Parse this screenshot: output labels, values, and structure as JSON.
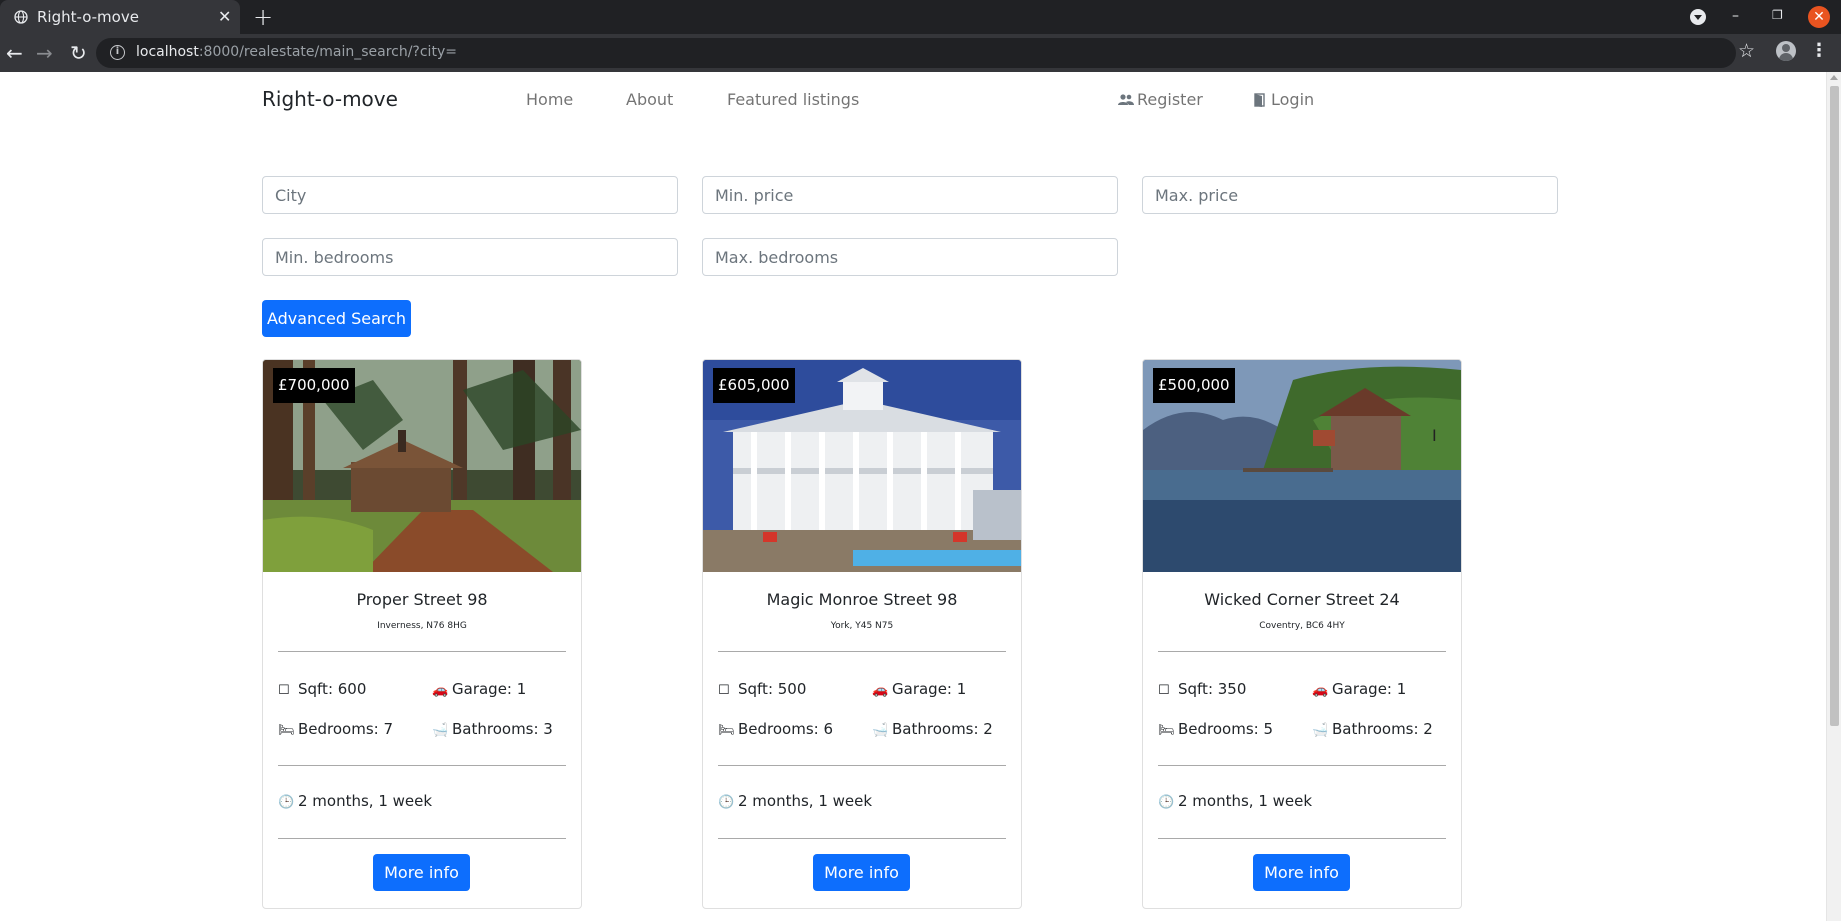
{
  "browser": {
    "tab_title": "Right-o-move",
    "url_host": "localhost",
    "url_rest": ":8000/realestate/main_search/?city="
  },
  "site": {
    "brand": "Right-o-move",
    "nav": {
      "home": "Home",
      "about": "About",
      "featured": "Featured listings",
      "register": "Register",
      "login": "Login"
    }
  },
  "search": {
    "city_placeholder": "City",
    "min_price_placeholder": "Min. price",
    "max_price_placeholder": "Max. price",
    "min_bedrooms_placeholder": "Min. bedrooms",
    "max_bedrooms_placeholder": "Max. bedrooms",
    "button_label": "Advanced Search"
  },
  "listings": [
    {
      "price": "£700,000",
      "title": "Proper Street 98",
      "location": "Inverness, N76 8HG",
      "sqft": "Sqft: 600",
      "garage": "Garage: 1",
      "bedrooms": "Bedrooms: 7",
      "bathrooms": "Bathrooms: 3",
      "listed": "2 months, 1 week",
      "button": "More info"
    },
    {
      "price": "£605,000",
      "title": "Magic Monroe Street 98",
      "location": "York, Y45 N75",
      "sqft": "Sqft: 500",
      "garage": "Garage: 1",
      "bedrooms": "Bedrooms: 6",
      "bathrooms": "Bathrooms: 2",
      "listed": "2 months, 1 week",
      "button": "More info"
    },
    {
      "price": "£500,000",
      "title": "Wicked Corner Street 24",
      "location": "Coventry, BC6 4HY",
      "sqft": "Sqft: 350",
      "garage": "Garage: 1",
      "bedrooms": "Bedrooms: 5",
      "bathrooms": "Bathrooms: 2",
      "listed": "2 months, 1 week",
      "button": "More info"
    }
  ],
  "icons": {
    "sqft": "square-outline-icon",
    "garage": "car-icon",
    "bedrooms": "bed-icon",
    "bathrooms": "bath-icon",
    "listed": "clock-icon",
    "register": "users-icon",
    "login": "door-icon"
  },
  "colors": {
    "primary": "#0d6efd",
    "badge_bg": "#000000",
    "chrome_dark": "#202124"
  }
}
